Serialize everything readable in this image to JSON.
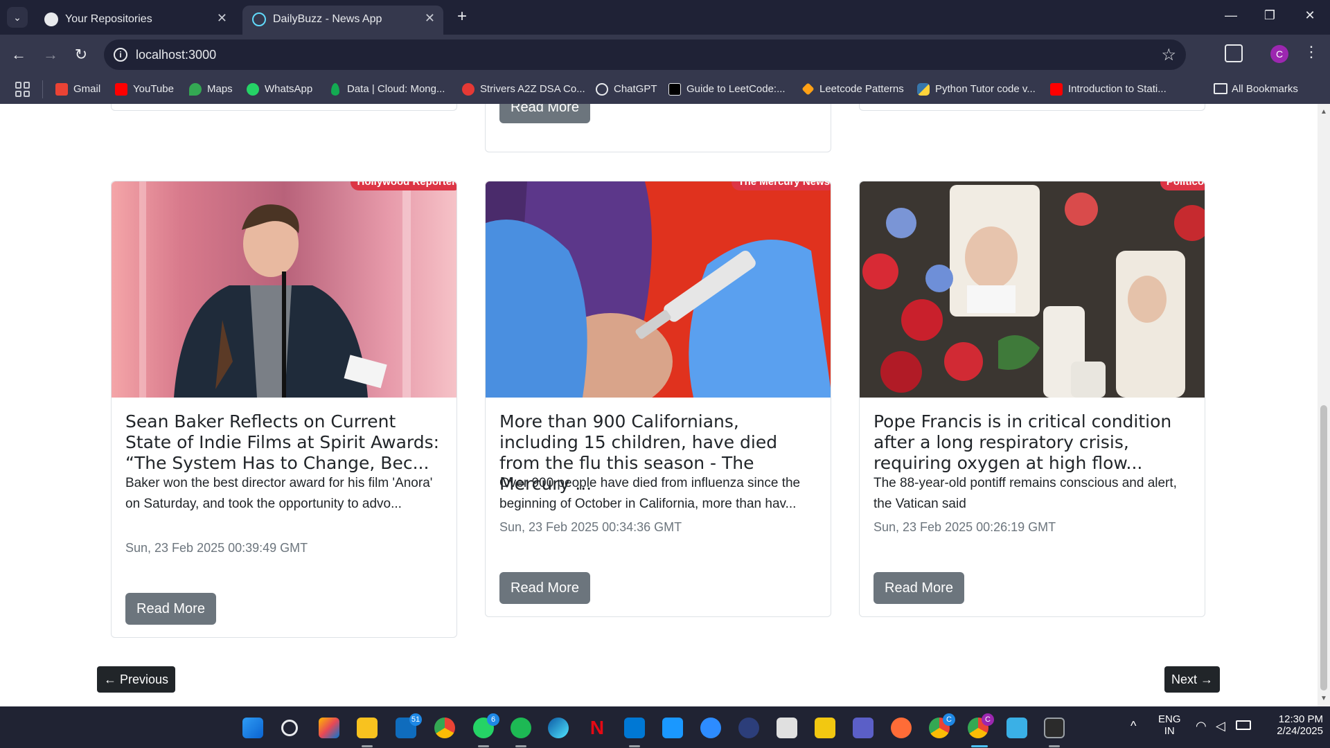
{
  "browser": {
    "tabs": [
      {
        "title": "Your Repositories",
        "icon": "github-icon"
      },
      {
        "title": "DailyBuzz - News App",
        "icon": "react-icon"
      }
    ],
    "url": "localhost:3000",
    "profile_initial": "C"
  },
  "bookmarks": {
    "items": [
      {
        "label": "Gmail",
        "icon": "gmail-icon",
        "color": "#ea4335"
      },
      {
        "label": "YouTube",
        "icon": "youtube-icon",
        "color": "#ff0000"
      },
      {
        "label": "Maps",
        "icon": "maps-icon",
        "color": "#34a853"
      },
      {
        "label": "WhatsApp",
        "icon": "whatsapp-icon",
        "color": "#25d366"
      },
      {
        "label": "Data | Cloud: Mong...",
        "icon": "mongodb-icon",
        "color": "#13aa52"
      },
      {
        "label": "Strivers A2Z DSA Co...",
        "icon": "tuf-icon",
        "color": "#e53935"
      },
      {
        "label": "ChatGPT",
        "icon": "chatgpt-icon",
        "color": "#e8eaed"
      },
      {
        "label": "Guide to LeetCode:...",
        "icon": "dev-icon",
        "color": "#000000"
      },
      {
        "label": "Leetcode Patterns",
        "icon": "leetcode-icon",
        "color": "#ffa116"
      },
      {
        "label": "Python Tutor code v...",
        "icon": "python-icon",
        "color": "#3776ab"
      },
      {
        "label": "Introduction to Stati...",
        "icon": "youtube-icon",
        "color": "#ff0000"
      }
    ],
    "all_bookmarks": "All Bookmarks"
  },
  "page": {
    "read_more": "Read More",
    "cards": [
      {
        "source": "Hollywood Reporter",
        "title": "Sean Baker Reflects on Current State of Indie Films at Spirit Awards: “The System Has to Change, Bec...",
        "description": "Baker won the best director award for his film 'Anora' on Saturday, and took the opportunity to advo...",
        "date": "Sun, 23 Feb 2025 00:39:49 GMT"
      },
      {
        "source": "The Mercury News",
        "title": "More than 900 Californians, including 15 children, have died from the flu this season - The Mercury ...",
        "description": "Over 900 people have died from influenza since the beginning of October in California, more than hav...",
        "date": "Sun, 23 Feb 2025 00:34:36 GMT"
      },
      {
        "source": "Politico",
        "title": "Pope Francis is in critical condition after a long respiratory crisis, requiring oxygen at high flow...",
        "description": "The 88-year-old pontiff remains conscious and alert, the Vatican said",
        "date": "Sun, 23 Feb 2025 00:26:19 GMT"
      }
    ],
    "pagination": {
      "previous": "← Previous",
      "next": "Next →"
    }
  },
  "taskbar": {
    "badges": {
      "outlook": "51",
      "whatsapp": "6",
      "chrome_profile": "C"
    },
    "language": "ENG",
    "region": "IN",
    "time": "12:30 PM",
    "date": "2/24/2025"
  },
  "colors": {
    "badge": "#dc3545",
    "button_secondary": "#6c757d",
    "button_dark": "#212529",
    "browser_frame": "#35384d"
  }
}
